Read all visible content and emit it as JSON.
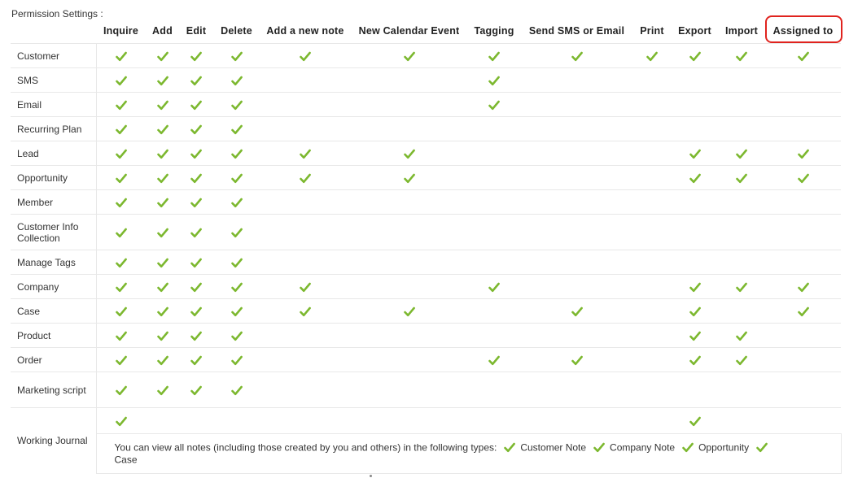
{
  "page": {
    "title": "Permission Settings :"
  },
  "colors": {
    "check": "#7cb82f",
    "highlight_border": "#e0231e",
    "row_border": "#e8e8e8"
  },
  "columns": [
    "Inquire",
    "Add",
    "Edit",
    "Delete",
    "Add a new note",
    "New Calendar Event",
    "Tagging",
    "Send SMS or Email",
    "Print",
    "Export",
    "Import",
    "Assigned to"
  ],
  "highlighted_column": "Assigned to",
  "rows": [
    {
      "label": "Customer",
      "checks": [
        1,
        1,
        1,
        1,
        1,
        1,
        1,
        1,
        1,
        1,
        1,
        1
      ]
    },
    {
      "label": "SMS",
      "checks": [
        1,
        1,
        1,
        1,
        0,
        0,
        1,
        0,
        0,
        0,
        0,
        0
      ]
    },
    {
      "label": "Email",
      "checks": [
        1,
        1,
        1,
        1,
        0,
        0,
        1,
        0,
        0,
        0,
        0,
        0
      ]
    },
    {
      "label": "Recurring Plan",
      "checks": [
        1,
        1,
        1,
        1,
        0,
        0,
        0,
        0,
        0,
        0,
        0,
        0
      ]
    },
    {
      "label": "Lead",
      "checks": [
        1,
        1,
        1,
        1,
        1,
        1,
        0,
        0,
        0,
        1,
        1,
        1
      ]
    },
    {
      "label": "Opportunity",
      "checks": [
        1,
        1,
        1,
        1,
        1,
        1,
        0,
        0,
        0,
        1,
        1,
        1
      ]
    },
    {
      "label": "Member",
      "checks": [
        1,
        1,
        1,
        1,
        0,
        0,
        0,
        0,
        0,
        0,
        0,
        0
      ]
    },
    {
      "label": "Customer Info Collection",
      "checks": [
        1,
        1,
        1,
        1,
        0,
        0,
        0,
        0,
        0,
        0,
        0,
        0
      ]
    },
    {
      "label": "Manage Tags",
      "checks": [
        1,
        1,
        1,
        1,
        0,
        0,
        0,
        0,
        0,
        0,
        0,
        0
      ]
    },
    {
      "label": "Company",
      "checks": [
        1,
        1,
        1,
        1,
        1,
        0,
        1,
        0,
        0,
        1,
        1,
        1
      ]
    },
    {
      "label": "Case",
      "checks": [
        1,
        1,
        1,
        1,
        1,
        1,
        0,
        1,
        0,
        1,
        0,
        1
      ]
    },
    {
      "label": "Product",
      "checks": [
        1,
        1,
        1,
        1,
        0,
        0,
        0,
        0,
        0,
        1,
        1,
        0
      ]
    },
    {
      "label": "Order",
      "checks": [
        1,
        1,
        1,
        1,
        0,
        0,
        1,
        1,
        0,
        1,
        1,
        0
      ]
    },
    {
      "label": "Marketing script",
      "checks": [
        1,
        1,
        1,
        1,
        0,
        0,
        0,
        0,
        0,
        0,
        0,
        0
      ]
    }
  ],
  "working_journal": {
    "label": "Working Journal",
    "checks": [
      1,
      0,
      0,
      0,
      0,
      0,
      0,
      0,
      0,
      1,
      0,
      0
    ],
    "note_text": "You can view all notes (including those created by you and others) in the following types:",
    "note_types": [
      "Customer Note",
      "Company Note",
      "Opportunity",
      "Case"
    ]
  }
}
